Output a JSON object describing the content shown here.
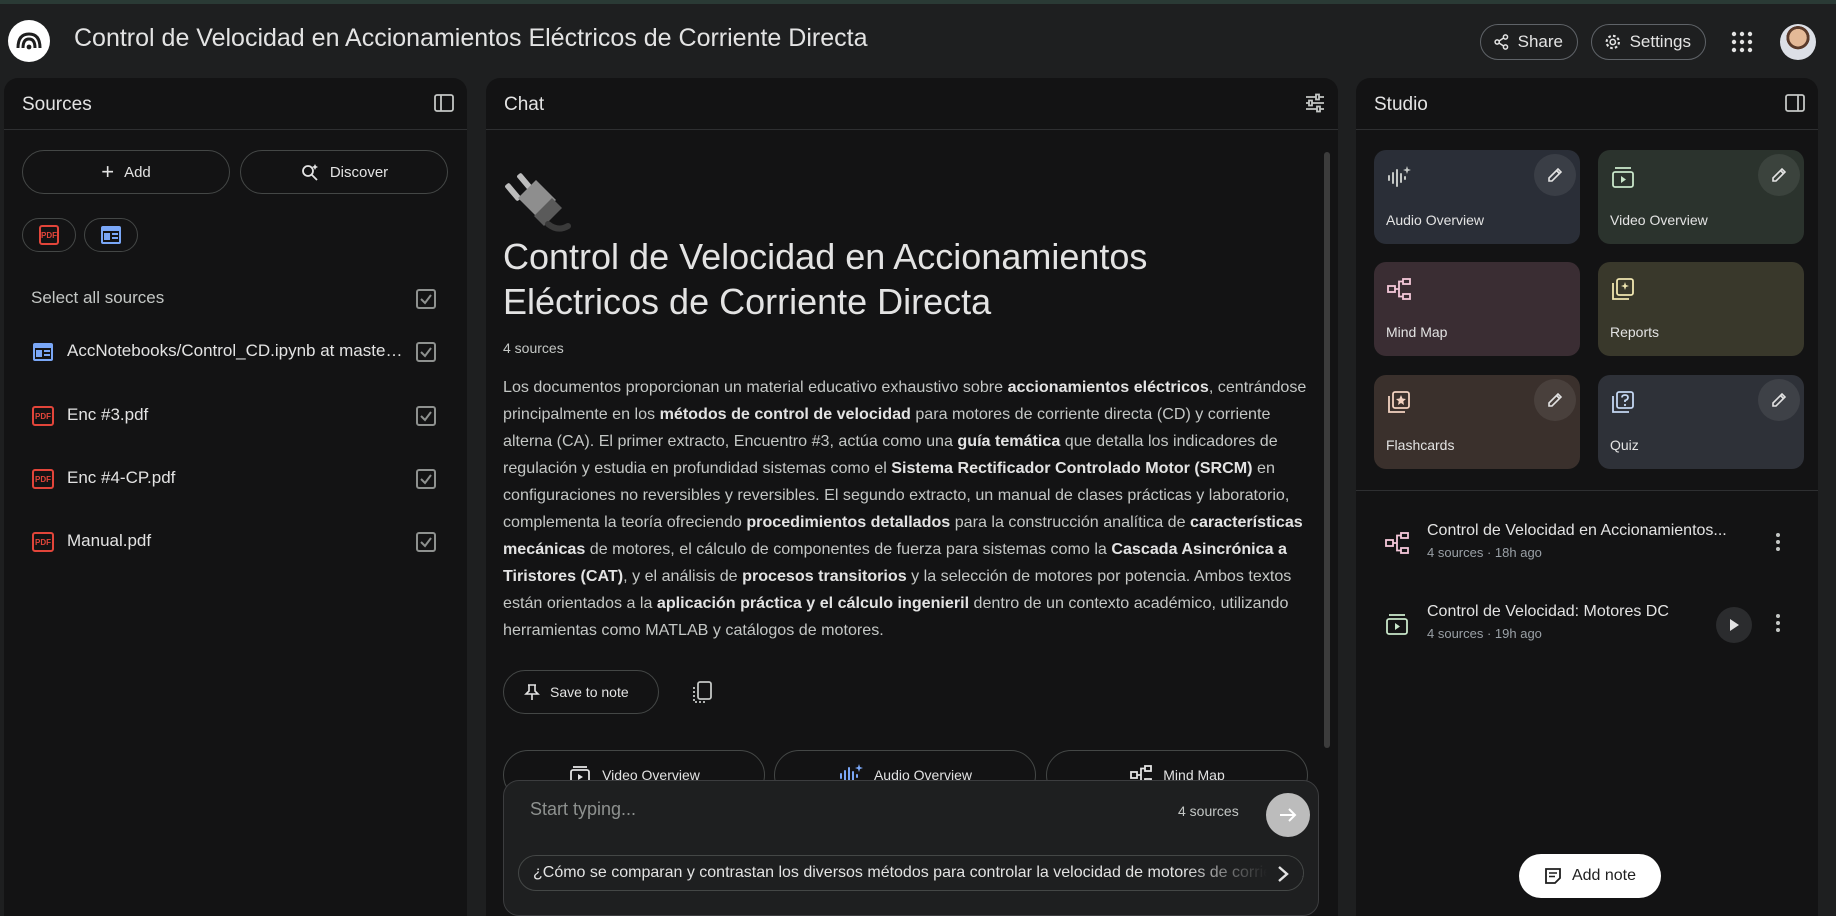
{
  "header": {
    "title": "Control de Velocidad en Accionamientos Eléctricos de Corriente Directa",
    "share_label": "Share",
    "settings_label": "Settings"
  },
  "sources": {
    "title": "Sources",
    "add_label": "Add",
    "discover_label": "Discover",
    "chip_pdf": "PDF",
    "select_all_label": "Select all sources",
    "items": [
      {
        "label": "AccNotebooks/Control_CD.ipynb at master · v...",
        "type": "web",
        "checked": true
      },
      {
        "label": "Enc #3.pdf",
        "type": "pdf",
        "checked": true
      },
      {
        "label": "Enc #4-CP.pdf",
        "type": "pdf",
        "checked": true
      },
      {
        "label": "Manual.pdf",
        "type": "pdf",
        "checked": true
      }
    ]
  },
  "chat": {
    "title": "Chat",
    "notebook_title": "Control de Velocidad en Accionamientos Eléctricos de Corriente Directa",
    "sources_count": "4 sources",
    "summary_parts": [
      {
        "t": "Los documentos proporcionan un material educativo exhaustivo sobre ",
        "b": false
      },
      {
        "t": "accionamientos eléctricos",
        "b": true
      },
      {
        "t": ", centrándose principalmente en los ",
        "b": false
      },
      {
        "t": "métodos de control de velocidad",
        "b": true
      },
      {
        "t": " para motores de corriente directa (CD) y corriente alterna (CA). El primer extracto, Encuentro #3, actúa como una ",
        "b": false
      },
      {
        "t": "guía temática",
        "b": true
      },
      {
        "t": " que detalla los indicadores de regulación y estudia en profundidad sistemas como el ",
        "b": false
      },
      {
        "t": "Sistema Rectificador Controlado Motor (SRCM)",
        "b": true
      },
      {
        "t": " en configuraciones no reversibles y reversibles. El segundo extracto, un manual de clases prácticas y laboratorio, complementa la teoría ofreciendo ",
        "b": false
      },
      {
        "t": "procedimientos detallados",
        "b": true
      },
      {
        "t": " para la construcción analítica de ",
        "b": false
      },
      {
        "t": "características mecánicas",
        "b": true
      },
      {
        "t": " de motores, el cálculo de componentes de fuerza para sistemas como la ",
        "b": false
      },
      {
        "t": "Cascada Asincrónica a Tiristores (CAT)",
        "b": true
      },
      {
        "t": ", y el análisis de ",
        "b": false
      },
      {
        "t": "procesos transitorios",
        "b": true
      },
      {
        "t": " y la selección de motores por potencia. Ambos textos están orientados a la ",
        "b": false
      },
      {
        "t": "aplicación práctica y el cálculo ingenieril",
        "b": true
      },
      {
        "t": " dentro de un contexto académico, utilizando herramientas como MATLAB y catálogos de motores.",
        "b": false
      }
    ],
    "save_to_note_label": "Save to note",
    "suggestions": [
      "Video Overview",
      "Audio Overview",
      "Mind Map"
    ],
    "input_placeholder": "Start typing...",
    "input_sources": "4 sources",
    "followup": "¿Cómo se comparan y contrastan los diversos métodos para controlar la velocidad de motores de corriente directa?"
  },
  "studio": {
    "title": "Studio",
    "tiles": [
      {
        "label": "Audio Overview",
        "icon": "audio-spark-icon"
      },
      {
        "label": "Video Overview",
        "icon": "video-overview-icon"
      },
      {
        "label": "Mind Map",
        "icon": "mind-map-icon"
      },
      {
        "label": "Reports",
        "icon": "reports-icon"
      },
      {
        "label": "Flashcards",
        "icon": "flashcards-icon"
      },
      {
        "label": "Quiz",
        "icon": "quiz-icon"
      }
    ],
    "notes": [
      {
        "title": "Control de Velocidad en Accionamientos...",
        "meta": "4 sources · 18h ago"
      },
      {
        "title": "Control de Velocidad: Motores DC",
        "meta": "4 sources · 19h ago"
      }
    ],
    "add_note_label": "Add note"
  },
  "colors": {
    "background": "#1e1f20",
    "panel": "#131314",
    "pdf_red": "#e2453a",
    "web_blue": "#7aa7f7"
  }
}
